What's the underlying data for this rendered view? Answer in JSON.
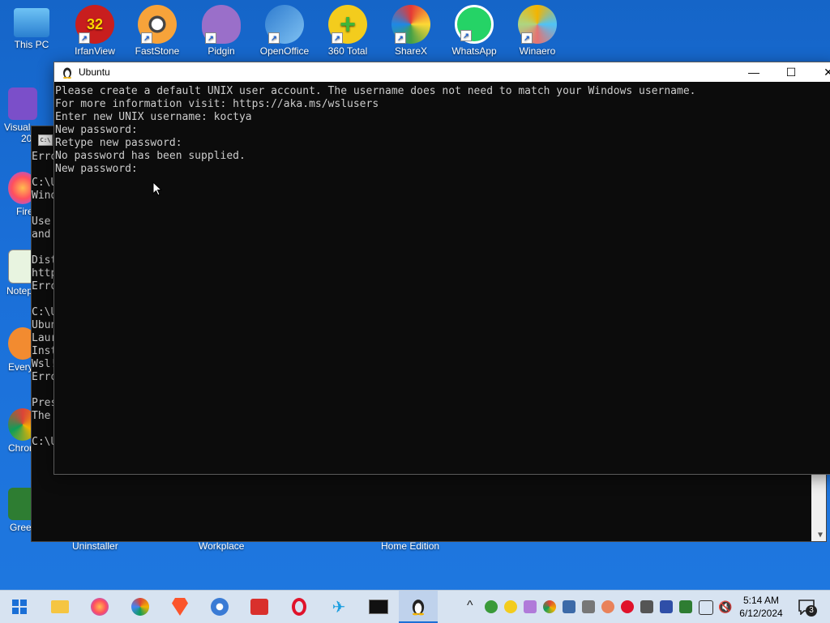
{
  "desktop": {
    "top_icons": [
      {
        "label": "This PC",
        "badge": ""
      },
      {
        "label": "IrfanView",
        "badge": "32"
      },
      {
        "label": "FastStone",
        "badge": ""
      },
      {
        "label": "Pidgin",
        "badge": ""
      },
      {
        "label": "OpenOffice",
        "badge": ""
      },
      {
        "label": "360 Total",
        "badge": ""
      },
      {
        "label": "ShareX",
        "badge": ""
      },
      {
        "label": "WhatsApp",
        "badge": ""
      },
      {
        "label": "Winaero",
        "badge": ""
      }
    ],
    "left_icons": [
      {
        "label": "Visual",
        "sub": "20"
      },
      {
        "label": "Fire"
      },
      {
        "label": "Notep"
      },
      {
        "label": "Every"
      },
      {
        "label": "Chron"
      },
      {
        "label": "Greer"
      }
    ],
    "bottom_labels": [
      "Uninstaller",
      "Workplace",
      "Home Edition"
    ]
  },
  "background_console": {
    "lines": [
      "Erro",
      "",
      "C:\\U",
      "Wind",
      "",
      "Use ",
      "and ",
      "",
      "Dist",
      "http",
      "Erro",
      "",
      "C:\\U",
      "Ubun",
      "Laur",
      "Inst",
      "Wsl!",
      "Erro",
      "",
      "Pres",
      "The ",
      "",
      "C:\\U"
    ]
  },
  "ubuntu_window": {
    "title": "Ubuntu",
    "controls": {
      "minimize": "—",
      "maximize": "☐",
      "close": "✕"
    },
    "terminal_lines": [
      "Please create a default UNIX user account. The username does not need to match your Windows username.",
      "For more information visit: https://aka.ms/wslusers",
      "Enter new UNIX username: koctya",
      "New password:",
      "Retype new password:",
      "No password has been supplied.",
      "New password:"
    ]
  },
  "taskbar": {
    "clock_time": "5:14 AM",
    "clock_date": "6/12/2024",
    "notification_count": "3",
    "tray_chevron": "^"
  }
}
